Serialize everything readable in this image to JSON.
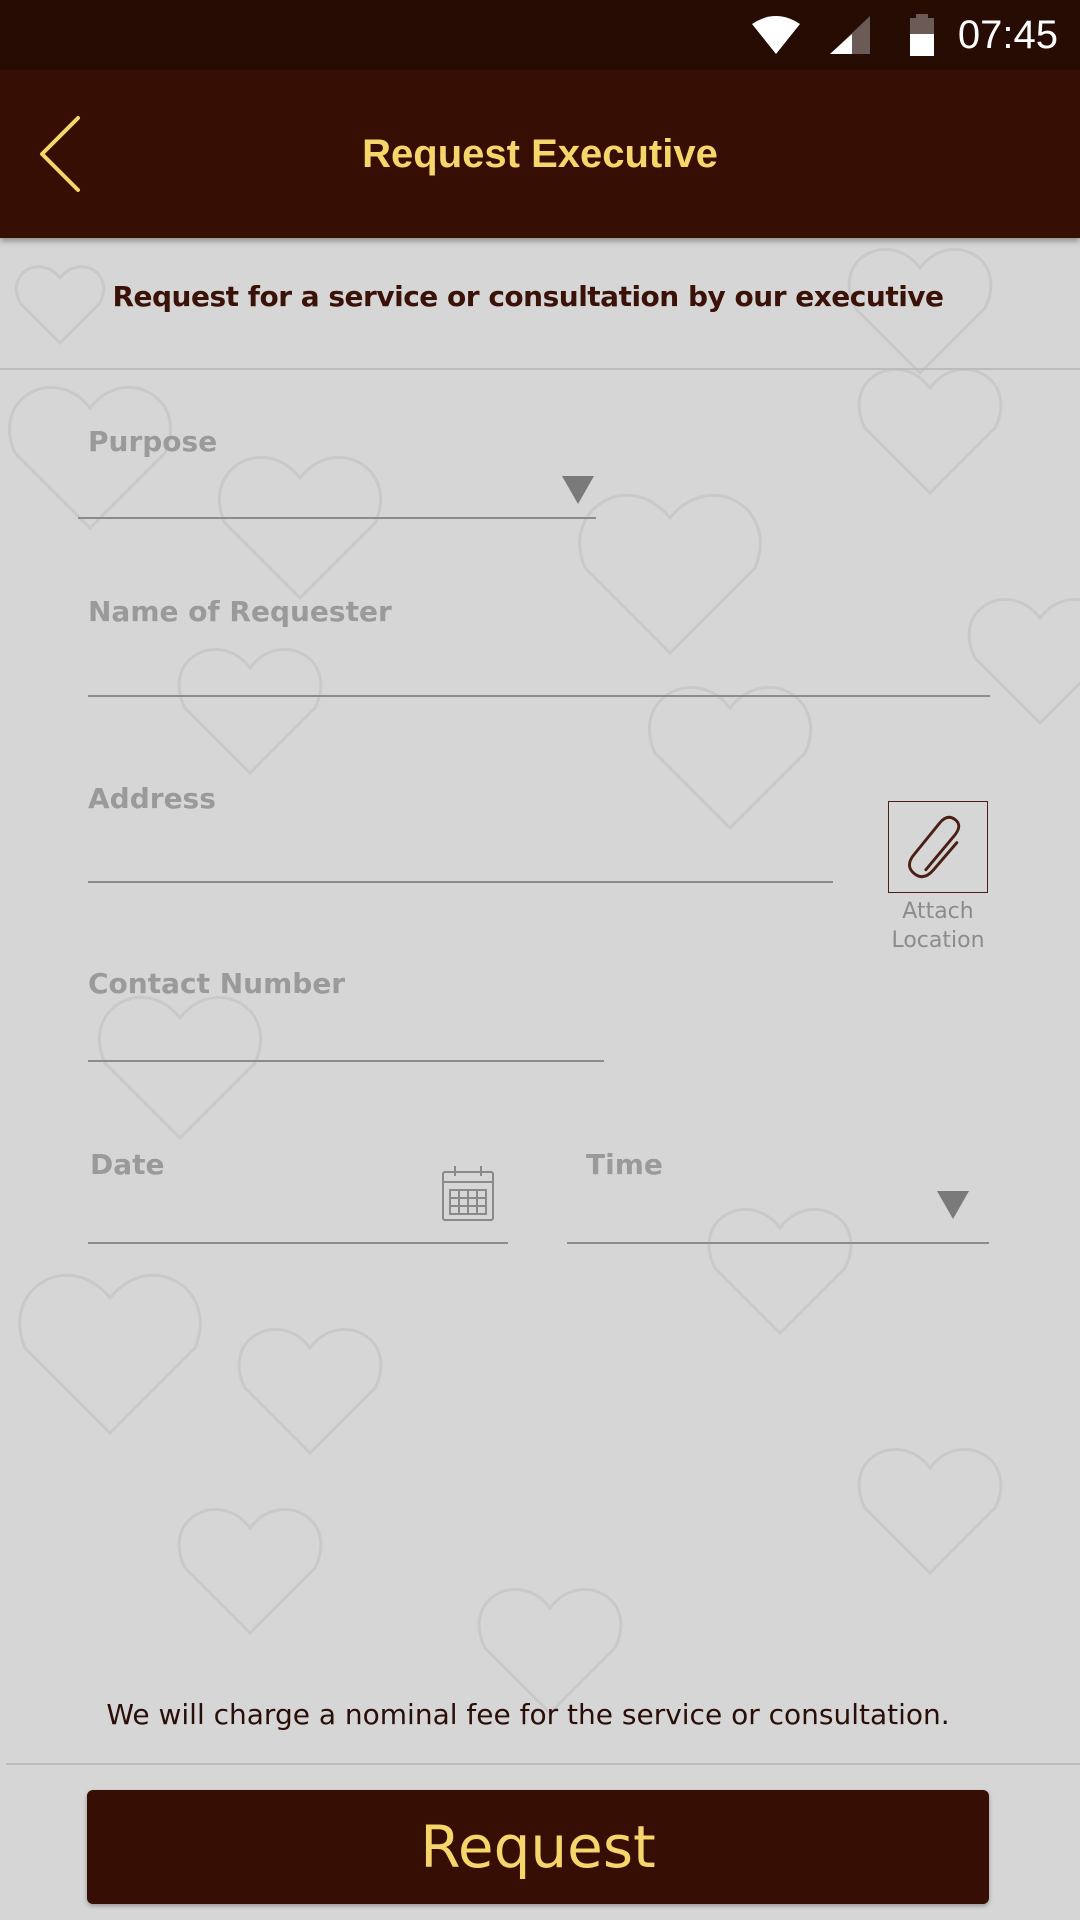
{
  "status_bar": {
    "time": "07:45",
    "icons": [
      "wifi-icon",
      "cellular-signal-icon",
      "battery-icon"
    ]
  },
  "app_bar": {
    "title": "Request Executive",
    "back_icon": "chevron-left-icon"
  },
  "subtitle": "Request for a service or consultation by our executive",
  "form": {
    "purpose": {
      "label": "Purpose",
      "value": "",
      "icon": "dropdown-arrow-icon"
    },
    "requester_name": {
      "label": "Name of Requester",
      "value": ""
    },
    "address": {
      "label": "Address",
      "value": ""
    },
    "attach_location": {
      "label": "Attach Location",
      "icon": "paperclip-icon"
    },
    "contact_number": {
      "label": "Contact Number",
      "value": ""
    },
    "date": {
      "label": "Date",
      "value": "",
      "icon": "calendar-icon"
    },
    "time": {
      "label": "Time",
      "value": "",
      "icon": "dropdown-arrow-icon"
    }
  },
  "fee_note": "We will charge a nominal fee for the service or consultation.",
  "request_button": {
    "label": "Request"
  },
  "colors": {
    "status_bar": "#270c04",
    "app_bar": "#360e04",
    "accent_gold": "#f6d56a",
    "background": "#d6d6d6",
    "label_gray": "#9a9a9a"
  }
}
